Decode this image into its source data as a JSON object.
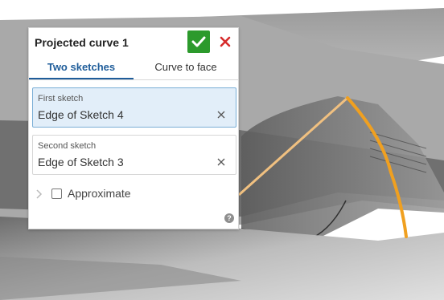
{
  "dialog": {
    "title": "Projected curve 1",
    "tabs": [
      {
        "label": "Two sketches",
        "active": true
      },
      {
        "label": "Curve to face",
        "active": false
      }
    ],
    "fields": [
      {
        "label": "First sketch",
        "value": "Edge of Sketch 4",
        "selected": true
      },
      {
        "label": "Second sketch",
        "value": "Edge of Sketch 3",
        "selected": false
      }
    ],
    "approximate": {
      "label": "Approximate",
      "checked": false
    },
    "help_glyph": "?"
  },
  "colors": {
    "accept": "#2c9a2c",
    "cancel": "#d62b2b",
    "tab_active": "#1f5d9a",
    "selection_bg": "#e2eef9",
    "projected_curve": "#f0a020",
    "sketch_edge": "#f0c080"
  },
  "icons": [
    "check-icon",
    "close-icon",
    "clear-icon",
    "chevron-right-icon",
    "help-icon"
  ]
}
